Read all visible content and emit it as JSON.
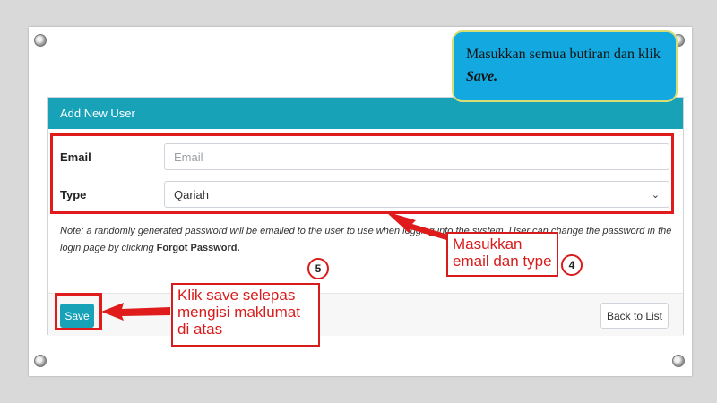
{
  "card": {
    "header_title": "Add New User",
    "email_label": "Email",
    "email_placeholder": "Email",
    "type_label": "Type",
    "type_selected": "Qariah",
    "note_prefix": "Note: a randomly generated password will be emailed to the user to use when logging into the system. User can change the password in the login page by clicking ",
    "note_link": "Forgot Password.",
    "save_label": "Save",
    "back_label": "Back to List"
  },
  "annotations": {
    "bubble_text": "Masukkan semua butiran dan klik ",
    "bubble_bold": "Save.",
    "callout4_text": "Masukkan email dan type",
    "step4": "4",
    "callout5_text": "Klik save selepas mengisi maklumat di atas",
    "step5": "5"
  },
  "colors": {
    "header": "#17a2b8",
    "annotation_red": "#e01b1b",
    "bubble_fill": "#13a9e0",
    "bubble_border": "#d8de73"
  }
}
